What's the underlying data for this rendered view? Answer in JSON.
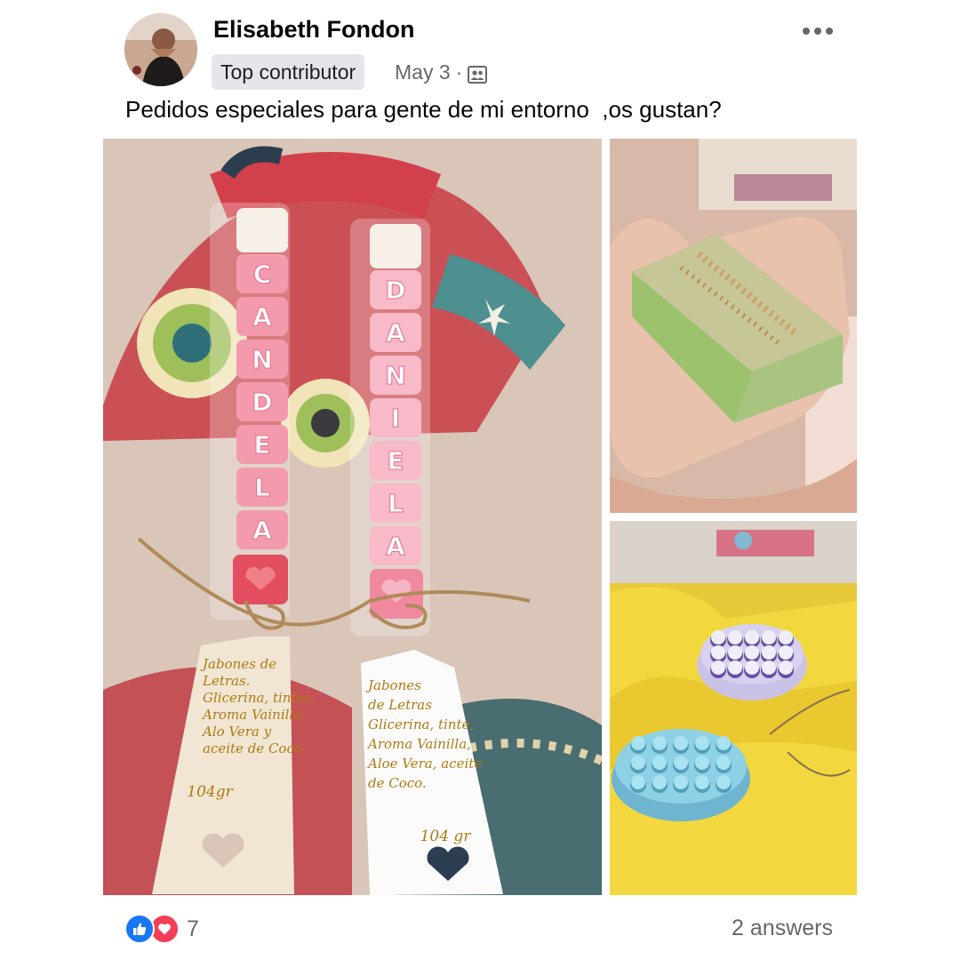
{
  "post": {
    "author": "Elisabeth Fondon",
    "badge": "Top contributor",
    "date": "May 3",
    "separator": "·",
    "privacy_icon": "group-icon",
    "text": "Pedidos especiales para gente de mi entorno  ,os gustan?"
  },
  "photos": {
    "main": {
      "bar1_letters": [
        "C",
        "A",
        "N",
        "D",
        "E",
        "L",
        "A"
      ],
      "bar2_letters": [
        "D",
        "A",
        "N",
        "I",
        "E",
        "L",
        "A"
      ],
      "tag1_lines": [
        "Jabones de",
        "Letras.",
        "Glicerina, tintes,",
        "Aroma Vainilla,",
        "Alo Vera y",
        "aceite de Coco."
      ],
      "tag1_weight": "104gr",
      "tag2_lines": [
        "Jabones",
        "de Letras",
        "Glicerina, tinte,",
        "Aroma Vainilla,",
        "Aloe Vera, aceite",
        "de Coco."
      ],
      "tag2_weight": "104 gr"
    }
  },
  "footer": {
    "reaction_count": "7",
    "answers": "2 answers"
  },
  "colors": {
    "like": "#1877f2",
    "love": "#f33e58",
    "meta_gray": "#65676b"
  }
}
